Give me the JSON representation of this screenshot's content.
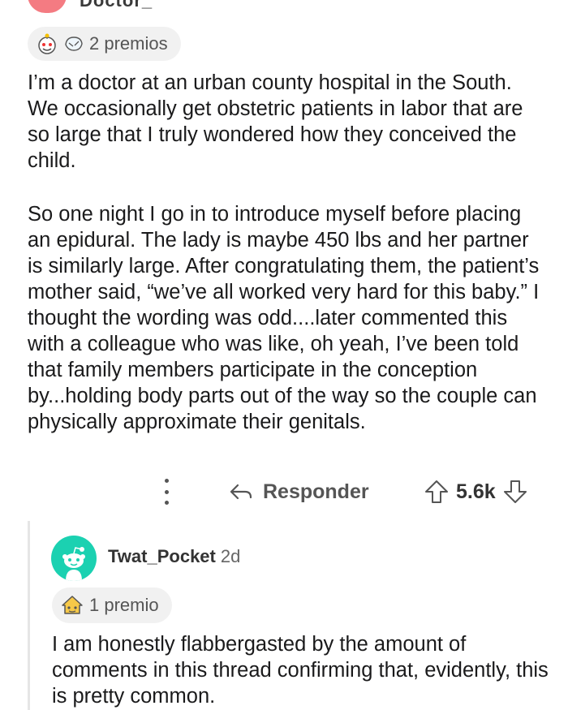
{
  "post": {
    "author_partial": "Doctor_",
    "awards_label": "2 premios",
    "paragraphs": [
      "I’m a doctor at an urban county hospital in the South. We occasionally get obstetric patients in labor that are so large that I truly wondered how they conceived the child.",
      "So one night I go in to introduce myself before placing an epidural. The lady is maybe 450 lbs and her partner is similarly large. After congratulating them, the patient’s mother said, “we’ve all worked very hard for this baby.” I thought the wording was odd....later commented this with a colleague who was like, oh yeah, I’ve been told that family members participate in the conception by...holding body parts out of the way so the couple can physically approximate their genitals."
    ],
    "reply_label": "Responder",
    "vote_count": "5.6k",
    "icons": {
      "more": "more-options-icon",
      "reply": "reply-arrow-icon",
      "upvote": "upvote-icon",
      "downvote": "downvote-icon",
      "award_1": "wholesome-award-icon",
      "award_2": "hugz-award-icon"
    }
  },
  "reply": {
    "author": "Twat_Pocket",
    "time": "2d",
    "awards_label": "1 premio",
    "text": "I am honestly flabbergasted by the amount of comments in this thread confirming that, evidently, this is pretty common.",
    "icons": {
      "avatar": "snoo-avatar",
      "award": "helpful-award-icon"
    }
  },
  "colors": {
    "avatar_top": "#f47b82",
    "avatar_reply": "#1bd1b1",
    "text": "#1a1a1b",
    "muted": "#555555",
    "pill_bg": "#f1f1f1"
  }
}
